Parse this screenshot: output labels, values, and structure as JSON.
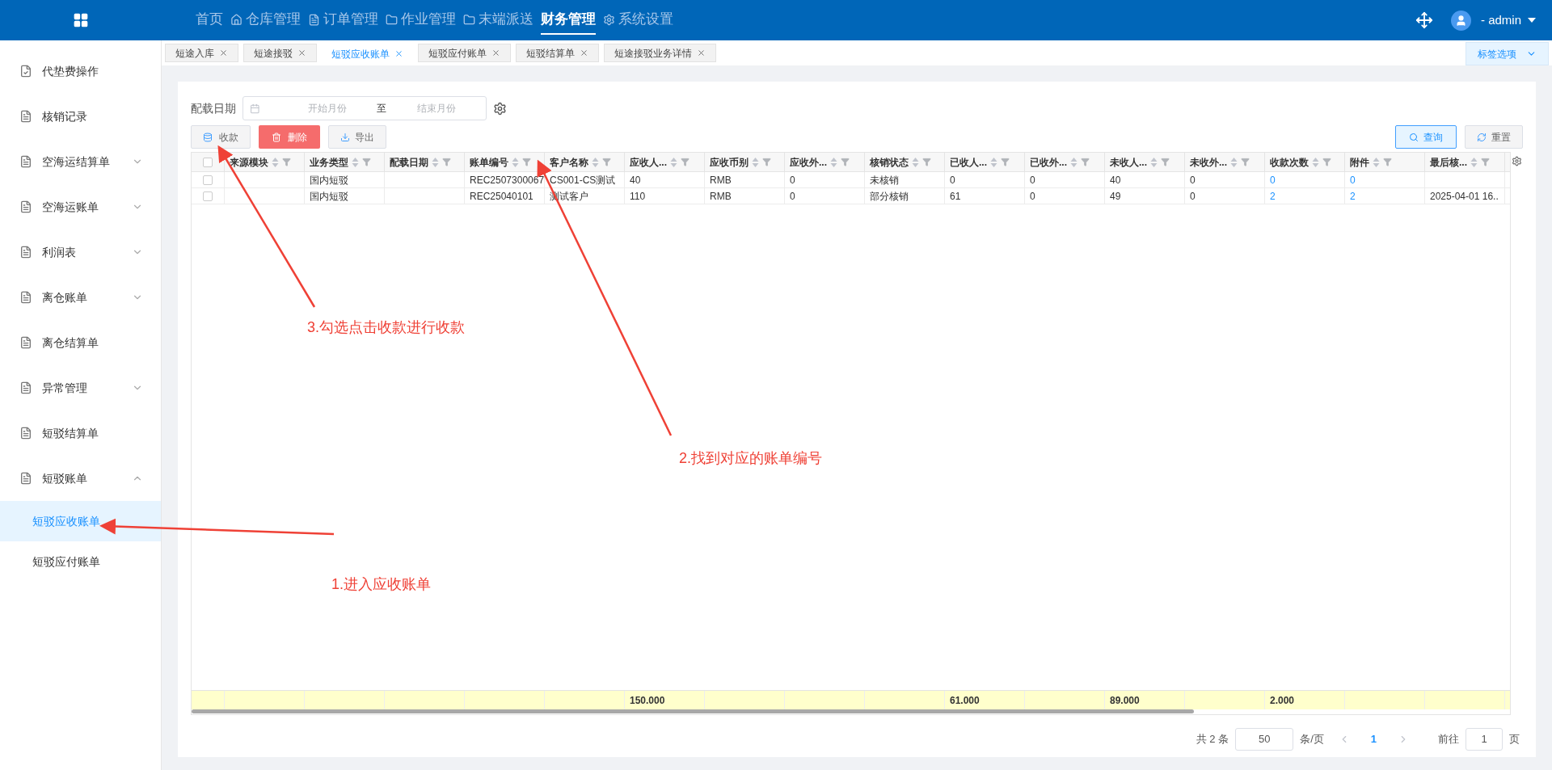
{
  "top_nav": {
    "items": [
      {
        "label": "首页",
        "selected": false
      },
      {
        "label": "仓库管理",
        "selected": false
      },
      {
        "label": "订单管理",
        "selected": false
      },
      {
        "label": "作业管理",
        "selected": false
      },
      {
        "label": "末端派送",
        "selected": false
      },
      {
        "label": "财务管理",
        "selected": true
      },
      {
        "label": "系统设置",
        "selected": false
      }
    ],
    "user": "- admin"
  },
  "sidebar": {
    "items": [
      {
        "label": "代垫费操作",
        "expandable": false
      },
      {
        "label": "核销记录",
        "expandable": false
      },
      {
        "label": "空海运结算单",
        "expandable": true,
        "expanded": false
      },
      {
        "label": "空海运账单",
        "expandable": true,
        "expanded": false
      },
      {
        "label": "利润表",
        "expandable": true,
        "expanded": false
      },
      {
        "label": "离仓账单",
        "expandable": true,
        "expanded": false
      },
      {
        "label": "离仓结算单",
        "expandable": false
      },
      {
        "label": "异常管理",
        "expandable": true,
        "expanded": false
      },
      {
        "label": "短驳结算单",
        "expandable": false
      },
      {
        "label": "短驳账单",
        "expandable": true,
        "expanded": true,
        "children": [
          {
            "label": "短驳应收账单",
            "selected": true
          },
          {
            "label": "短驳应付账单",
            "selected": false
          }
        ]
      }
    ]
  },
  "tabs": [
    {
      "label": "短途入库",
      "selected": false
    },
    {
      "label": "短途接驳",
      "selected": false
    },
    {
      "label": "短驳应收账单",
      "selected": true
    },
    {
      "label": "短驳应付账单",
      "selected": false
    },
    {
      "label": "短驳结算单",
      "selected": false
    },
    {
      "label": "短途接驳业务详情",
      "selected": false
    }
  ],
  "tab_options": "标签选项",
  "filter": {
    "label": "配载日期",
    "start_placeholder": "开始月份",
    "separator": "至",
    "end_placeholder": "结束月份"
  },
  "buttons": {
    "collect": "收款",
    "delete": "删除",
    "export": "导出",
    "search": "查询",
    "reset": "重置"
  },
  "table": {
    "all_selected": false,
    "columns": [
      {
        "label": "来源模块",
        "kind": "text"
      },
      {
        "label": "业务类型",
        "kind": "text"
      },
      {
        "label": "配载日期",
        "kind": "text"
      },
      {
        "label": "账单编号",
        "kind": "text"
      },
      {
        "label": "客户名称",
        "kind": "text"
      },
      {
        "label": "应收人...",
        "kind": "text",
        "total": "150.000"
      },
      {
        "label": "应收币别",
        "kind": "text"
      },
      {
        "label": "应收外...",
        "kind": "text"
      },
      {
        "label": "核销状态",
        "kind": "text"
      },
      {
        "label": "已收人...",
        "kind": "text",
        "total": "61.000"
      },
      {
        "label": "已收外...",
        "kind": "text"
      },
      {
        "label": "未收人...",
        "kind": "text",
        "total": "89.000"
      },
      {
        "label": "未收外...",
        "kind": "text"
      },
      {
        "label": "收款次数",
        "kind": "link",
        "total": "2.000"
      },
      {
        "label": "附件",
        "kind": "link"
      },
      {
        "label": "最后核...",
        "kind": "text"
      }
    ],
    "rows": [
      {
        "selected": false,
        "cells": [
          null,
          "国内短驳",
          null,
          "REC2507300067",
          "CS001-CS测试",
          "40",
          "RMB",
          "0",
          "未核销",
          "0",
          "0",
          "40",
          "0",
          "0",
          "0",
          null
        ]
      },
      {
        "selected": false,
        "cells": [
          null,
          "国内短驳",
          null,
          "REC25040101",
          "测试客户",
          "110",
          "RMB",
          "0",
          "部分核销",
          "61",
          "0",
          "49",
          "0",
          "2",
          "2",
          "2025-04-01 16.."
        ]
      }
    ]
  },
  "pagination": {
    "total": "共 2 条",
    "page_size": "50",
    "per_page": "条/页",
    "current_page": "1",
    "goto_label": "前往",
    "goto_value": "1",
    "page_unit": "页"
  },
  "annotations": [
    {
      "text": "1.进入应收账单"
    },
    {
      "text": "2.找到对应的账单编号"
    },
    {
      "text": "3.勾选点击收款进行收款"
    }
  ]
}
